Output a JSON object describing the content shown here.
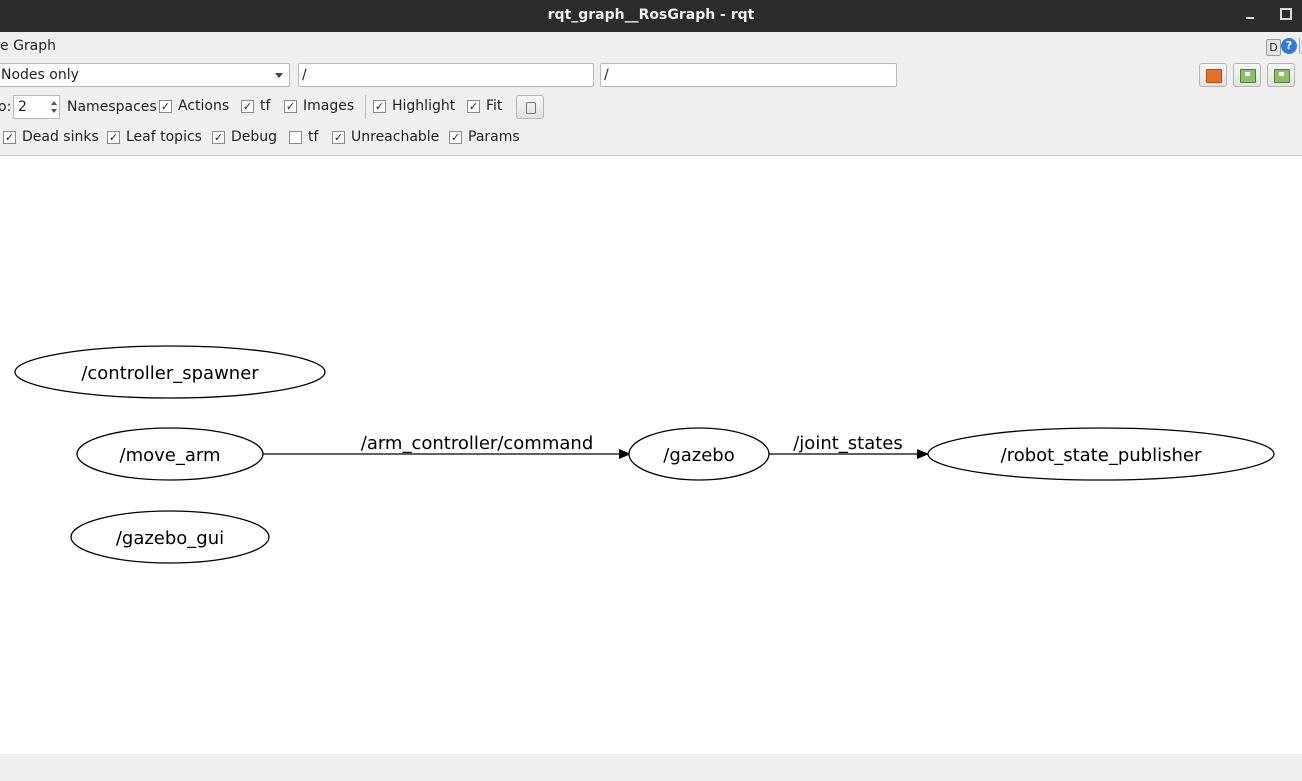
{
  "window": {
    "title": "rqt_graph__RosGraph - rqt"
  },
  "plugin": {
    "title": "e Graph",
    "d_label": "D",
    "help_label": "?"
  },
  "toolbar": {
    "mode": "Nodes only",
    "filter1": "/",
    "filter2": "/",
    "buttons": [
      "folder-icon",
      "save-icon",
      "save-dot-icon"
    ]
  },
  "options": {
    "depth_label": "o:",
    "depth_value": "2",
    "namespaces": "Namespaces",
    "actions": "Actions",
    "tf": "tf",
    "images": "Images",
    "highlight": "Highlight",
    "fit": "Fit"
  },
  "hide": {
    "dead_sinks": "Dead sinks",
    "leaf_topics": "Leaf topics",
    "debug": "Debug",
    "tf": "tf",
    "unreachable": "Unreachable",
    "params": "Params"
  },
  "checks": {
    "actions": true,
    "tf": true,
    "images": true,
    "highlight": true,
    "fit": true,
    "dead_sinks": true,
    "leaf_topics": true,
    "debug": true,
    "hide_tf": false,
    "unreachable": true,
    "params": true
  },
  "graph": {
    "nodes": [
      {
        "id": "controller_spawner",
        "label": "/controller_spawner"
      },
      {
        "id": "move_arm",
        "label": "/move_arm"
      },
      {
        "id": "gazebo_gui",
        "label": "/gazebo_gui"
      },
      {
        "id": "gazebo",
        "label": "/gazebo"
      },
      {
        "id": "robot_state_publisher",
        "label": "/robot_state_publisher"
      }
    ],
    "edges": [
      {
        "from": "move_arm",
        "to": "gazebo",
        "label": "/arm_controller/command"
      },
      {
        "from": "gazebo",
        "to": "robot_state_publisher",
        "label": "/joint_states"
      }
    ]
  }
}
